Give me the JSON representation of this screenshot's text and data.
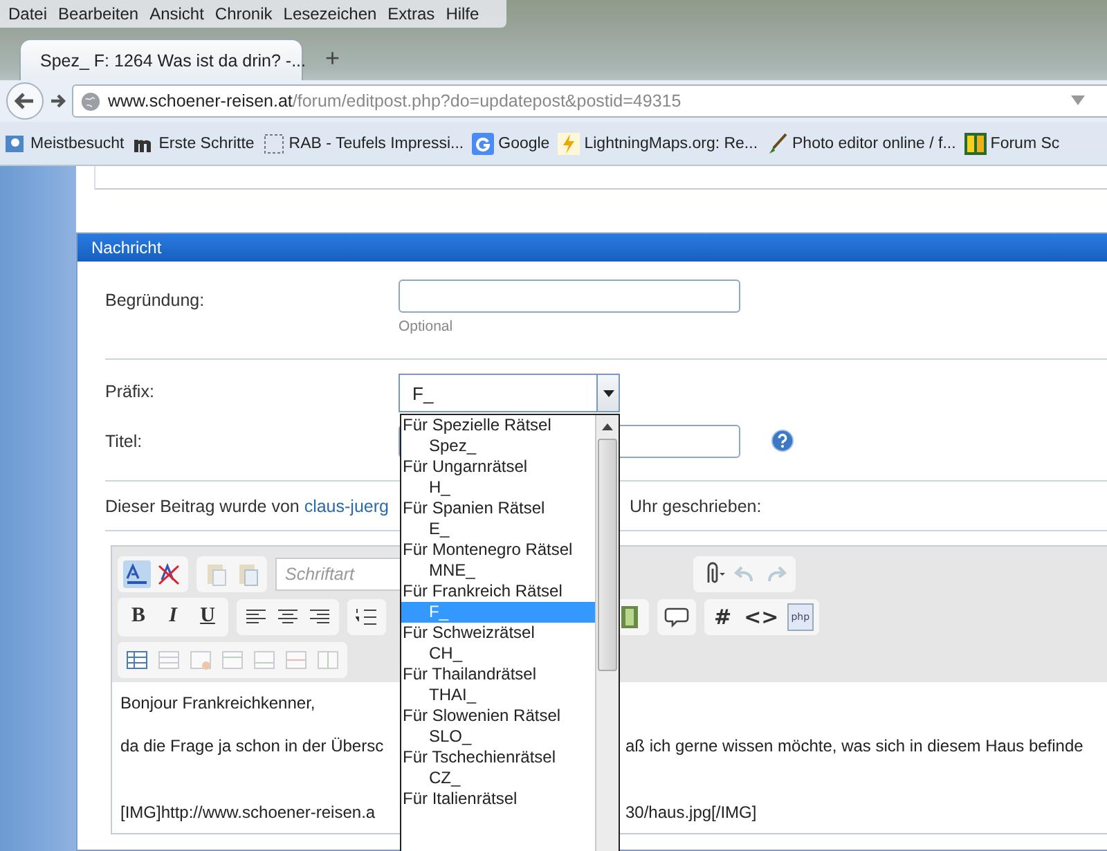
{
  "menu": [
    "Datei",
    "Bearbeiten",
    "Ansicht",
    "Chronik",
    "Lesezeichen",
    "Extras",
    "Hilfe"
  ],
  "tab": {
    "title": "Spez_ F: 1264 Was ist da drin? -...",
    "new_tab": "+"
  },
  "address": {
    "host": "www.schoener-reisen.at",
    "path": "/forum/editpost.php?do=updatepost&postid=49315"
  },
  "bookmarks": [
    {
      "label": "Meistbesucht",
      "kind": "folder"
    },
    {
      "label": "Erste Schritte",
      "kind": "m"
    },
    {
      "label": "RAB - Teufels Impressi...",
      "kind": "blank"
    },
    {
      "label": "Google",
      "kind": "google"
    },
    {
      "label": "LightningMaps.org: Re...",
      "kind": "map"
    },
    {
      "label": "Photo editor online / f...",
      "kind": "brush"
    },
    {
      "label": "Forum Sc",
      "kind": "logo"
    }
  ],
  "panel": {
    "title": "Nachricht"
  },
  "reason": {
    "label": "Begründung:",
    "hint": "Optional"
  },
  "prefix": {
    "label": "Präfix:",
    "value": "F_",
    "expanded": true,
    "groups": [
      {
        "label": "Für Spezielle Rätsel",
        "options": [
          {
            "label": "Spez_",
            "selected": false
          }
        ]
      },
      {
        "label": "Für Ungarnrätsel",
        "options": [
          {
            "label": "H_",
            "selected": false
          }
        ]
      },
      {
        "label": "Für Spanien Rätsel",
        "options": [
          {
            "label": "E_",
            "selected": false
          }
        ]
      },
      {
        "label": "Für Montenegro Rätsel",
        "options": [
          {
            "label": "MNE_",
            "selected": false
          }
        ]
      },
      {
        "label": "Für Frankreich Rätsel",
        "options": [
          {
            "label": "F_",
            "selected": true
          }
        ]
      },
      {
        "label": "Für Schweizrätsel",
        "options": [
          {
            "label": "CH_",
            "selected": false
          }
        ]
      },
      {
        "label": "Für Thailandrätsel",
        "options": [
          {
            "label": "THAI_",
            "selected": false
          }
        ]
      },
      {
        "label": "Für Slowenien Rätsel",
        "options": [
          {
            "label": "SLO_",
            "selected": false
          }
        ]
      },
      {
        "label": "Für Tschechienrätsel",
        "options": [
          {
            "label": "CZ_",
            "selected": false
          }
        ]
      },
      {
        "label": "Für Italienrätsel"
      }
    ]
  },
  "title_field": {
    "label": "Titel:"
  },
  "author_note": {
    "before": "Dieser Beitrag wurde von",
    "link": "claus-juerg",
    "after": "Uhr geschrieben:"
  },
  "toolbar": {
    "font_select": "Schriftart",
    "format_buttons": [
      "B",
      "I",
      "U"
    ],
    "code_buttons": [
      "#",
      "<>"
    ],
    "php_label": "php"
  },
  "editor_lines": [
    {
      "parts": [
        "Bonjour Frankreichkenner,"
      ]
    },
    {
      "parts": [
        "da die Frage ja schon in der Übersc",
        "aß ich gerne wissen möchte, was sich in diesem Haus befinde"
      ]
    },
    {
      "parts": [
        "[IMG]http://www.schoener-reisen.a",
        "30/haus.jpg[/IMG]"
      ]
    }
  ]
}
